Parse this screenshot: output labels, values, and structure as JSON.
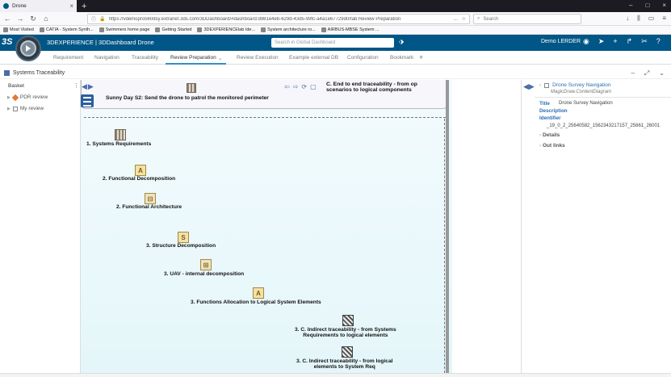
{
  "browser": {
    "tab_title": "Drone",
    "url": "https://vdemopro560dsy.extranet.3ds.com/3DDashboard/#dashboard:d981e4eb-629d-43d5-99fc-a4a1e67729d0/tab:Review Preparation",
    "search_placeholder": "Search",
    "bookmarks": [
      "Most Visited",
      "CATIA - System Synth...",
      "Swimmers home page",
      "Getting Started",
      "3DEXPERIENCElab Ide...",
      "System architecture ro...",
      "AIRBUS-MBSE System ..."
    ]
  },
  "app": {
    "title": "3DEXPERIENCE | 3DDashboard  Drone",
    "search_placeholder": "Search in Global Dashboard",
    "user": "Demo LERDER"
  },
  "dashboard_tabs": [
    "Requirement",
    "Navigation",
    "Traceability",
    "Review Preparation",
    "Review Execution",
    "Example external DB",
    "Configuration",
    "Bookmark"
  ],
  "widget": {
    "title": "Systems Traceability"
  },
  "basket": {
    "title": "Basket",
    "items": [
      "PDR review",
      "My review"
    ]
  },
  "diagram": {
    "header_left": "Sunny Day S2: Send the drone to patrol the monitored perimeter",
    "header_right": "C. End to end traceability - from op scenarios to logical components",
    "nodes": [
      {
        "label": "1. Systems Requirements",
        "icon": "grid-icon"
      },
      {
        "label": "2. Functional Decomposition",
        "icon": "letter-a-icon"
      },
      {
        "label": "2. Functional Architecture",
        "icon": "component-icon"
      },
      {
        "label": "3. Structure Decomposition",
        "icon": "letter-s-icon"
      },
      {
        "label": "3. UAV - internal decomposition",
        "icon": "internal-block-icon"
      },
      {
        "label": "3. Functions Allocation to Logical System Elements",
        "icon": "letter-a-icon"
      },
      {
        "label": "3. C. Indirect traceability - from Systems Requirements to logical elements",
        "line1": "3. C. Indirect traceability - from Systems",
        "line2": "Requirements to logical elements",
        "icon": "matrix-icon"
      },
      {
        "label": "3. C. Indirect traceability - from logical elements to System Req",
        "line1": "3. C. Indirect traceability - from logical",
        "line2": "elements to System Req",
        "icon": "matrix-icon"
      }
    ]
  },
  "properties": {
    "header": "Drone Survey Navigation",
    "subtitle": "MagicDraw.ContentDiagram",
    "title_label": "Title",
    "title_value": "Drone Survey Navigation",
    "description_label": "Description",
    "identifier_label": "Identifier",
    "identifier_value": "_19_0_2_25640582_1562343217157_25661_26001",
    "sections": [
      "Details",
      "Out links"
    ]
  }
}
